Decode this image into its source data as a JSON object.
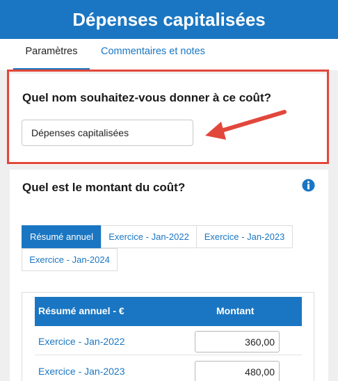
{
  "header": {
    "title": "Dépenses capitalisées"
  },
  "tabs": {
    "params_label": "Paramètres",
    "comments_label": "Commentaires et notes"
  },
  "name_section": {
    "question": "Quel nom souhaitez-vous donner à ce coût?",
    "input_value": "Dépenses capitalisées"
  },
  "amount_section": {
    "question": "Quel est le montant du coût?",
    "period_tabs": [
      {
        "label": "Résumé annuel",
        "active": true
      },
      {
        "label": "Exercice - Jan-2022",
        "active": false
      },
      {
        "label": "Exercice - Jan-2023",
        "active": false
      },
      {
        "label": "Exercice - Jan-2024",
        "active": false
      }
    ],
    "table": {
      "headers": [
        "Résumé annuel - €",
        "Montant"
      ],
      "rows": [
        {
          "label": "Exercice - Jan-2022",
          "value": "360,00"
        },
        {
          "label": "Exercice - Jan-2023",
          "value": "480,00"
        }
      ]
    }
  },
  "colors": {
    "primary": "#1a76c2",
    "highlight": "#e2473b",
    "background": "#efefef"
  },
  "icons": {
    "info": "info-icon",
    "annotation": "red-arrow"
  }
}
